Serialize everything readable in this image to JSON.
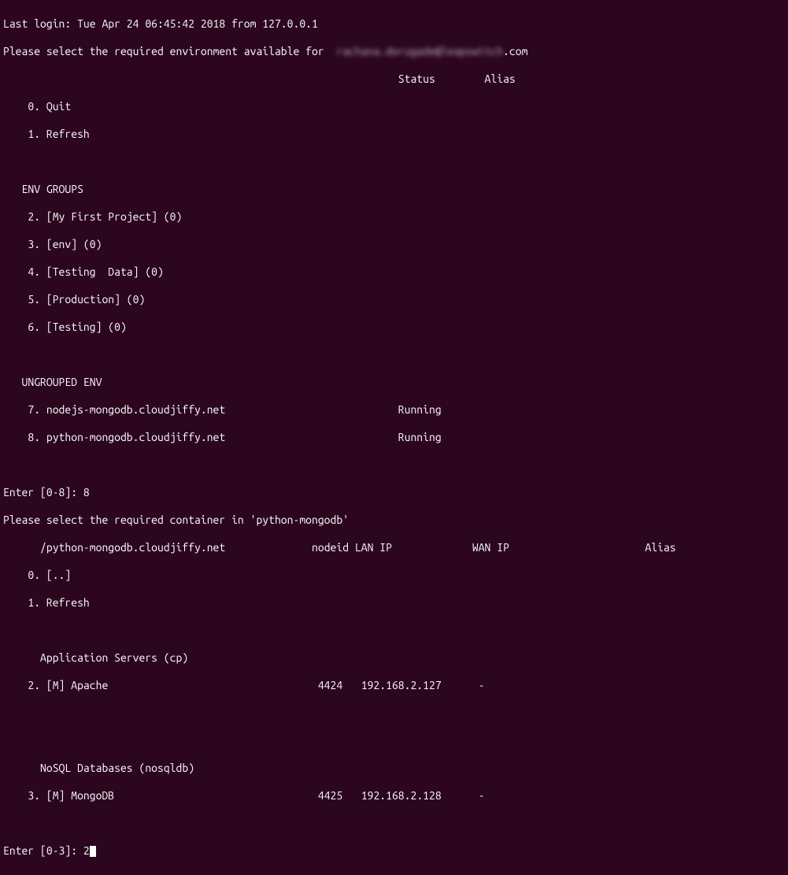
{
  "login_line": "Last login: Tue Apr 24 06:45:42 2018 from 127.0.0.1",
  "select_env_prefix": "Please select the required environment available for  ",
  "blurred_user": "rachana.dorugade@leapswitch",
  "select_env_suffix": ".com",
  "header_status": "Status",
  "header_alias": "Alias",
  "quit": "    0. Quit",
  "refresh": "    1. Refresh",
  "env_groups_title": "   ENV GROUPS",
  "env_groups": [
    "    2. [My First Project] (0)",
    "    3. [env] (0)",
    "    4. [Testing  Data] (0)",
    "    5. [Production] (0)",
    "    6. [Testing] (0)"
  ],
  "ungrouped_title": "   UNGROUPED ENV",
  "ungrouped": [
    {
      "text": "    7. nodejs-mongodb.cloudjiffy.net",
      "status": "Running"
    },
    {
      "text": "    8. python-mongodb.cloudjiffy.net",
      "status": "Running"
    }
  ],
  "enter1_prompt": "Enter [0-8]: ",
  "enter1_value": "8",
  "select_container": "Please select the required container in 'python-mongodb'",
  "container_header_path": "      /python-mongodb.cloudjiffy.net",
  "container_header_nodeid": "nodeid",
  "container_header_lanip": "LAN IP",
  "container_header_wanip": "WAN IP",
  "container_header_alias": "Alias",
  "back": "    0. [..]",
  "refresh2": "    1. Refresh",
  "appservers_title": "      Application Servers (cp)",
  "appserver_row": {
    "name": "    2. [M] Apache",
    "nodeid": "4424",
    "lan": "192.168.2.127",
    "wan": "-"
  },
  "nosql_title": "      NoSQL Databases (nosqldb)",
  "nosql_row": {
    "name": "    3. [M] MongoDB",
    "nodeid": "4425",
    "lan": "192.168.2.128",
    "wan": "-"
  },
  "enter2_prompt": "Enter [0-3]: ",
  "enter2_value": "2"
}
